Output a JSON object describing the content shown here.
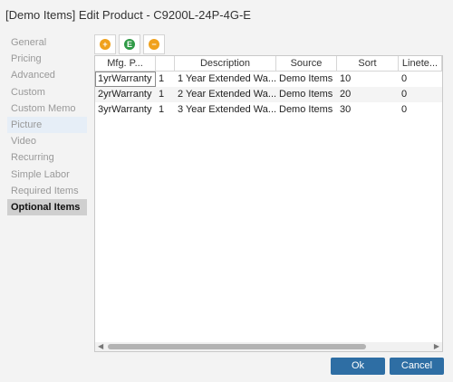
{
  "window": {
    "title": "[Demo Items] Edit Product - C9200L-24P-4G-E"
  },
  "nav": {
    "items": [
      {
        "label": "General",
        "state": "normal"
      },
      {
        "label": "Pricing",
        "state": "normal"
      },
      {
        "label": "Advanced",
        "state": "normal"
      },
      {
        "label": "Custom",
        "state": "normal"
      },
      {
        "label": "Custom Memo",
        "state": "normal"
      },
      {
        "label": "Picture",
        "state": "highlight"
      },
      {
        "label": "Video",
        "state": "normal"
      },
      {
        "label": "Recurring",
        "state": "normal"
      },
      {
        "label": "Simple Labor",
        "state": "normal"
      },
      {
        "label": "Required Items",
        "state": "normal"
      },
      {
        "label": "Optional Items",
        "state": "active"
      }
    ]
  },
  "toolbar": {
    "buttons": [
      {
        "name": "add-button",
        "icon": "plus-icon",
        "glyph": "+",
        "color": "#f0a11c"
      },
      {
        "name": "edit-button",
        "icon": "edit-icon",
        "glyph": "E",
        "color": "#2f9a46"
      },
      {
        "name": "remove-button",
        "icon": "minus-icon",
        "glyph": "−",
        "color": "#f0a11c"
      }
    ]
  },
  "grid": {
    "columns": [
      "Mfg. P...",
      "",
      "Description",
      "Source",
      "Sort",
      "Linete..."
    ],
    "rows": [
      [
        "1yrWarranty",
        "1",
        "1 Year Extended Wa...",
        "Demo Items",
        "10",
        "0"
      ],
      [
        "2yrWarranty",
        "1",
        "2 Year Extended Wa...",
        "Demo Items",
        "20",
        "0"
      ],
      [
        "3yrWarranty",
        "1",
        "3 Year Extended Wa...",
        "Demo Items",
        "30",
        "0"
      ]
    ]
  },
  "buttons": {
    "ok": "Ok",
    "cancel": "Cancel"
  }
}
